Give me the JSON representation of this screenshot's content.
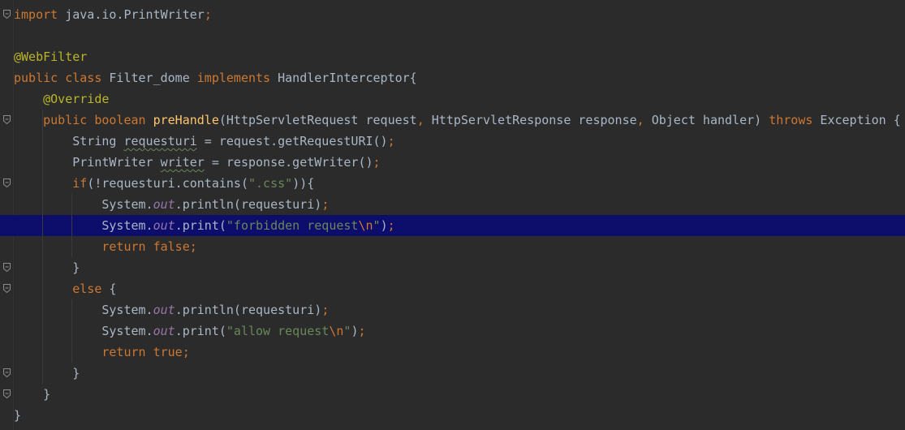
{
  "colors": {
    "background": "#2b2b2b",
    "keyword": "#cc7832",
    "annotation": "#bbb529",
    "string": "#6a8759",
    "method_decl": "#ffc66d",
    "static_field": "#9876aa",
    "default_text": "#a9b7c6",
    "current_line_highlight": "#0d0d6b"
  },
  "lines": [
    {
      "tokens": [
        [
          "kw",
          "import"
        ],
        [
          "plain",
          " java.io.PrintWriter"
        ],
        [
          "kw",
          ";"
        ]
      ],
      "fold": true
    },
    {
      "tokens": [],
      "fold": false
    },
    {
      "tokens": [
        [
          "ann",
          "@WebFilter"
        ]
      ],
      "fold": false
    },
    {
      "tokens": [
        [
          "kw",
          "public class"
        ],
        [
          "plain",
          " Filter_dome "
        ],
        [
          "kw",
          "implements"
        ],
        [
          "plain",
          " HandlerInterceptor{"
        ]
      ],
      "fold": false
    },
    {
      "tokens": [
        [
          "ann",
          "    @Override"
        ]
      ],
      "fold": false
    },
    {
      "tokens": [
        [
          "plain",
          "    "
        ],
        [
          "kw",
          "public boolean"
        ],
        [
          "plain",
          " "
        ],
        [
          "fn",
          "preHandle"
        ],
        [
          "plain",
          "(HttpServletRequest request"
        ],
        [
          "kw",
          ","
        ],
        [
          "plain",
          " HttpServletResponse response"
        ],
        [
          "kw",
          ","
        ],
        [
          "plain",
          " Object handler) "
        ],
        [
          "kw",
          "throws"
        ],
        [
          "plain",
          " Exception {"
        ]
      ],
      "fold": true
    },
    {
      "tokens": [
        [
          "plain",
          "        String "
        ],
        [
          "wavy",
          "requesturi"
        ],
        [
          "plain",
          " = request.getRequestURI()"
        ],
        [
          "kw",
          ";"
        ]
      ],
      "fold": false
    },
    {
      "tokens": [
        [
          "plain",
          "        PrintWriter "
        ],
        [
          "wavy",
          "writer"
        ],
        [
          "plain",
          " = response.getWriter()"
        ],
        [
          "kw",
          ";"
        ]
      ],
      "fold": false
    },
    {
      "tokens": [
        [
          "plain",
          "        "
        ],
        [
          "kw",
          "if"
        ],
        [
          "plain",
          "(!requesturi.contains("
        ],
        [
          "str",
          "\".css\""
        ],
        [
          "plain",
          "))"
        ],
        [
          "plain",
          "{"
        ]
      ],
      "fold": true
    },
    {
      "tokens": [
        [
          "plain",
          "            System."
        ],
        [
          "field",
          "out"
        ],
        [
          "plain",
          ".println(requesturi)"
        ],
        [
          "kw",
          ";"
        ]
      ],
      "fold": false
    },
    {
      "tokens": [
        [
          "plain",
          "            System."
        ],
        [
          "field",
          "out"
        ],
        [
          "plain",
          ".print("
        ],
        [
          "str",
          "\"forbidden request"
        ],
        [
          "esc",
          "\\n"
        ],
        [
          "str",
          "\""
        ],
        [
          "plain",
          ")"
        ],
        [
          "kw",
          ";"
        ]
      ],
      "fold": false,
      "highlight": true
    },
    {
      "tokens": [
        [
          "plain",
          "            "
        ],
        [
          "kw",
          "return false;"
        ]
      ],
      "fold": false
    },
    {
      "tokens": [
        [
          "plain",
          "        }"
        ]
      ],
      "fold": true
    },
    {
      "tokens": [
        [
          "plain",
          "        "
        ],
        [
          "kw",
          "else"
        ],
        [
          "plain",
          " {"
        ]
      ],
      "fold": true
    },
    {
      "tokens": [
        [
          "plain",
          "            System."
        ],
        [
          "field",
          "out"
        ],
        [
          "plain",
          ".println(requesturi)"
        ],
        [
          "kw",
          ";"
        ]
      ],
      "fold": false
    },
    {
      "tokens": [
        [
          "plain",
          "            System."
        ],
        [
          "field",
          "out"
        ],
        [
          "plain",
          ".print("
        ],
        [
          "str",
          "\"allow request"
        ],
        [
          "esc",
          "\\n"
        ],
        [
          "str",
          "\""
        ],
        [
          "plain",
          ")"
        ],
        [
          "kw",
          ";"
        ]
      ],
      "fold": false
    },
    {
      "tokens": [
        [
          "plain",
          "            "
        ],
        [
          "kw",
          "return true;"
        ]
      ],
      "fold": false
    },
    {
      "tokens": [
        [
          "plain",
          "        }"
        ]
      ],
      "fold": true
    },
    {
      "tokens": [
        [
          "plain",
          "    }"
        ]
      ],
      "fold": true
    },
    {
      "tokens": [
        [
          "plain",
          "}"
        ]
      ],
      "fold": false
    }
  ]
}
